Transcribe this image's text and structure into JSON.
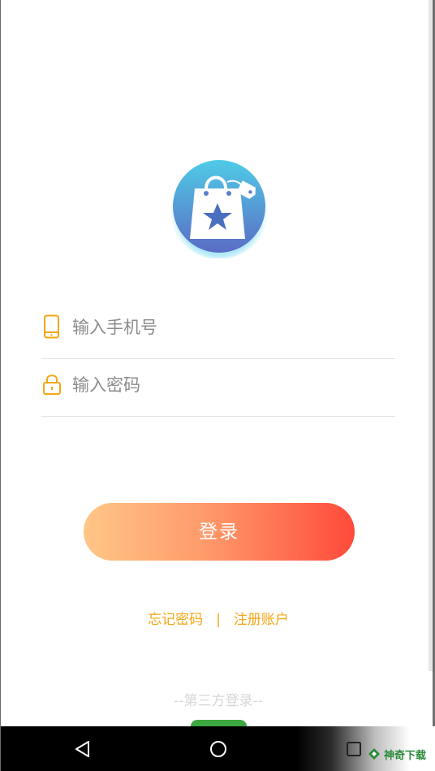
{
  "app": {
    "logo_icon": "shopping-bag-star-icon"
  },
  "login_form": {
    "phone": {
      "icon": "phone-icon",
      "placeholder": "输入手机号",
      "value": ""
    },
    "password": {
      "icon": "lock-icon",
      "placeholder": "输入密码",
      "value": ""
    },
    "login_button_label": "登录"
  },
  "links": {
    "forgot_password": "忘记密码",
    "separator": "|",
    "register": "注册账户"
  },
  "third_party": {
    "label": "--第三方登录--"
  },
  "system_nav": {
    "back_icon": "back-triangle-icon",
    "home_icon": "home-circle-icon",
    "recents_icon": "recents-square-icon"
  },
  "watermark": {
    "text": "神奇下载"
  },
  "colors": {
    "accent": "#f3a616",
    "button_gradient_start": "#ffc687",
    "button_gradient_end": "#ff4a3a",
    "logo_gradient_top": "#4fc9e6",
    "logo_gradient_bottom": "#5a72c8"
  }
}
